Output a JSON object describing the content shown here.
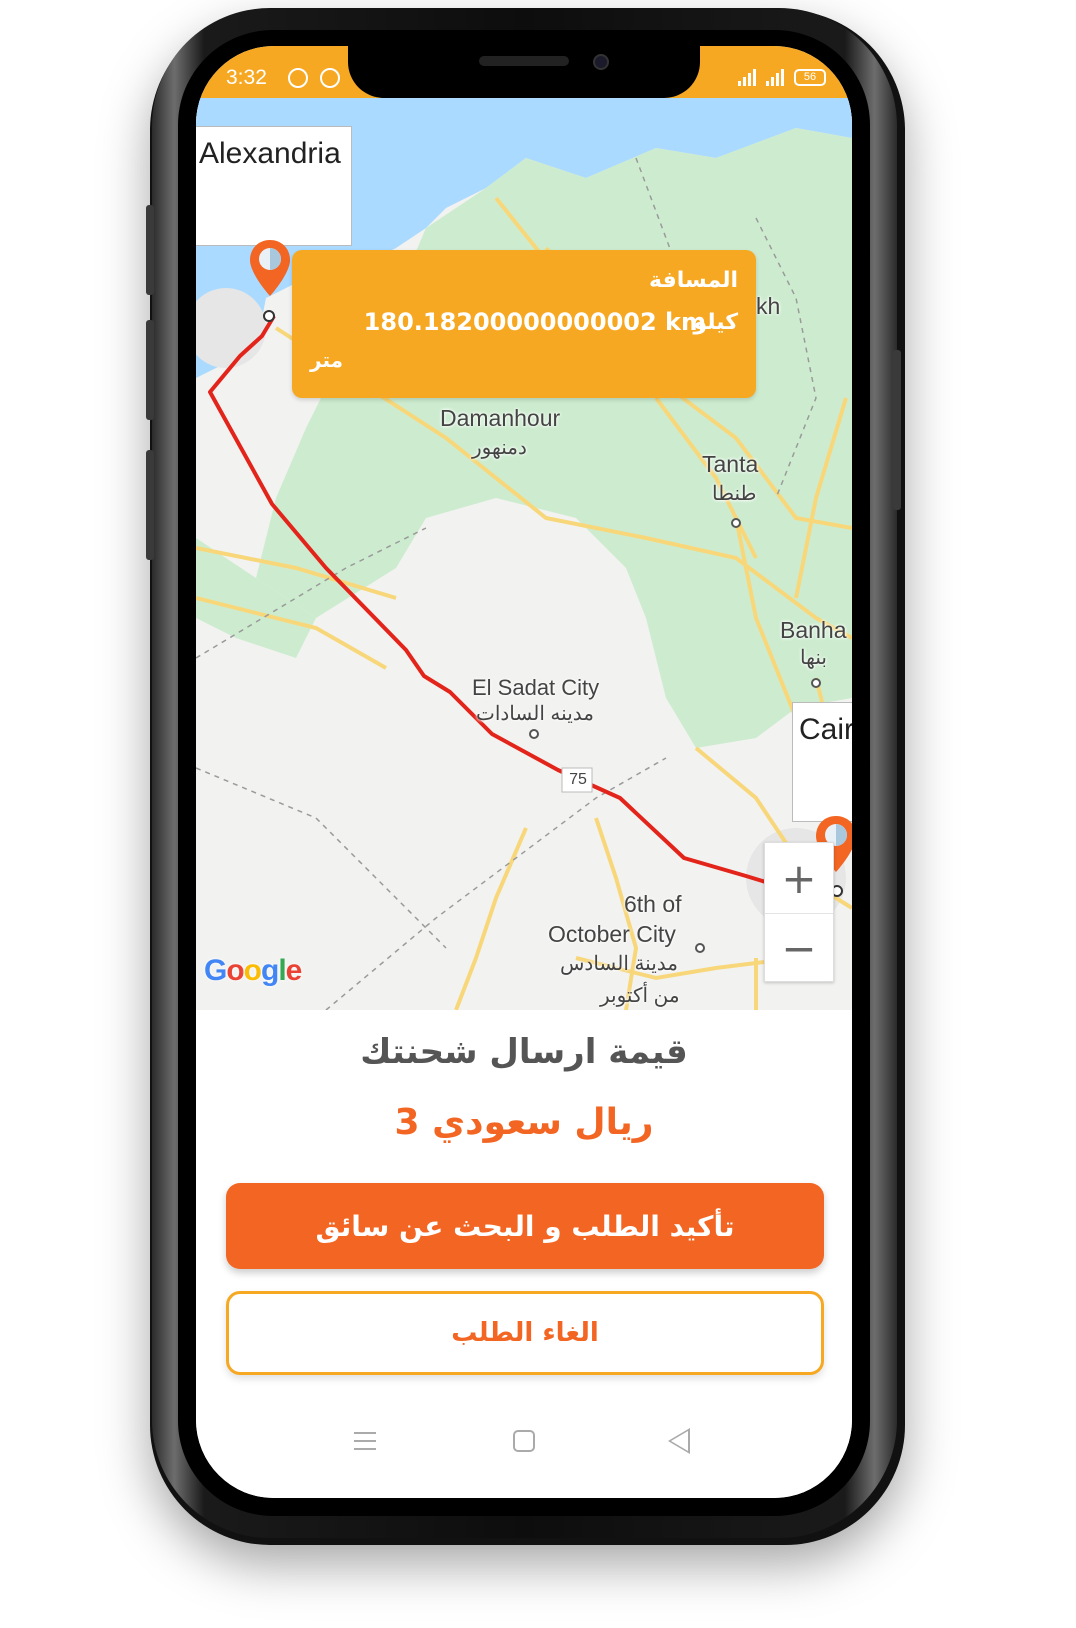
{
  "status_bar": {
    "time": "3:32",
    "icons": [
      "whatsapp-icon",
      "messenger-icon",
      "signal-icon",
      "signal-icon",
      "battery-icon"
    ],
    "battery_level": "56",
    "color": "#f7a823"
  },
  "map": {
    "origin_city": "Alexandria",
    "destination_city": "Cair",
    "labels": {
      "damanhour_en": "Damanhour",
      "damanhour_ar": "دمنهور",
      "tanta_en": "Tanta",
      "tanta_ar": "طنطا",
      "banha_en": "Banha",
      "banha_ar": "بنها",
      "sadat_en": "El Sadat City",
      "sadat_ar": "مدينه السادات",
      "october_en_1": "6th of",
      "october_en_2": "October City",
      "october_ar_1": "مدينة السادس",
      "october_ar_2": "من أكتوبر",
      "kafr_partial": "kh",
      "road_number": "75"
    },
    "distance": {
      "title": "المسافة",
      "value": "180.18200000000002 km",
      "unit_kilo": "كيلو",
      "unit_meter": "متر"
    },
    "zoom": {
      "plus": "+",
      "minus": "−"
    },
    "attribution": "Google",
    "route_color": "#e3241b"
  },
  "sheet": {
    "title": "قيمة ارسال شحنتك",
    "price": "3 ريال سعودي",
    "confirm_button": "تأكيد الطلب و البحث عن سائق",
    "cancel_button": "الغاء الطلب",
    "accent": "#f26522",
    "border_accent": "#f7a823"
  },
  "nav_bar": {
    "icons": [
      "menu-icon",
      "home-icon",
      "back-icon"
    ]
  }
}
